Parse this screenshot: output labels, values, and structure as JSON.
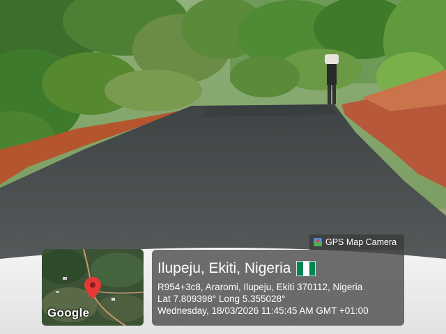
{
  "overlay": {
    "badge_label": "GPS Map Camera",
    "badge_icon": "gps-map-camera-icon",
    "location_title": "Ilupeju, Ekiti, Nigeria",
    "flag": "nigeria-flag-icon",
    "address": "R954+3c8, Araromi, Ilupeju, Ekiti 370112, Nigeria",
    "coordinates": "Lat 7.809398° Long 5.355028°",
    "datetime": "Wednesday, 18/03/2026 11:45:45 AM GMT +01:00",
    "map_logo": "Google"
  },
  "colors": {
    "flag_green": "#008751",
    "flag_white": "#ffffff",
    "pin_red": "#e53935",
    "panel_bg": "#464646"
  }
}
